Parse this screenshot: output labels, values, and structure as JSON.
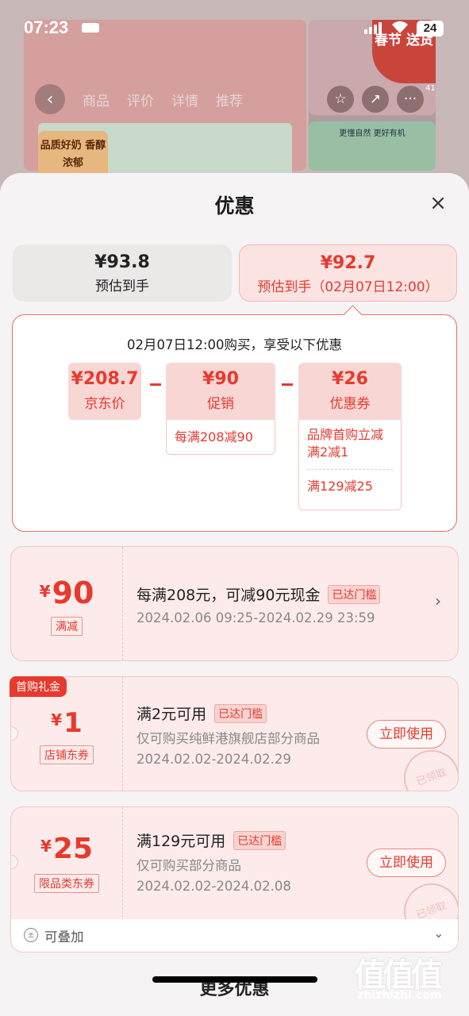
{
  "status_bar": {
    "time": "07:23",
    "battery": "24"
  },
  "background": {
    "nav_tabs": [
      "商品",
      "评价",
      "详情",
      "推荐"
    ],
    "hero_tag": "品质好奶 香醇浓郁",
    "ad_badge": "春节 送货",
    "ad_text": "更懂自然 更好有机",
    "cart_count": "41"
  },
  "sheet": {
    "title": "优惠",
    "close_icon": "close-icon",
    "price_tabs": [
      {
        "price": "¥93.8",
        "label": "预估到手"
      },
      {
        "price": "¥92.7",
        "label": "预估到手（02月07日12:00）"
      }
    ],
    "detail": {
      "header": "02月07日12:00购买，享受以下优惠",
      "jd_price": {
        "value": "¥208.7",
        "name": "京东价"
      },
      "promo": {
        "value": "¥90",
        "name": "促销",
        "desc": "每满208减90"
      },
      "coupon": {
        "value": "¥26",
        "name": "优惠券",
        "desc1": "品牌首购立减满2减1",
        "desc2": "满129减25"
      }
    },
    "offers": [
      {
        "amount": "90",
        "yen": "¥",
        "kind": "满减",
        "title": "每满208元，可减90元现金",
        "badge": "已达门槛",
        "date": "2024.02.06 09:25-2024.02.29 23:59"
      },
      {
        "tag": "首购礼金",
        "amount": "1",
        "yen": "¥",
        "kind": "店铺东券",
        "title": "满2元可用",
        "badge": "已达门槛",
        "desc": "仅可购买纯鲜港旗舰店部分商品",
        "date": "2024.02.02-2024.02.29",
        "button": "立即使用",
        "stamp": "已领取"
      },
      {
        "amount": "25",
        "yen": "¥",
        "kind": "限品类东券",
        "title": "满129元可用",
        "badge": "已达门槛",
        "desc": "仅可购买部分商品",
        "date": "2024.02.02-2024.02.08",
        "button": "立即使用",
        "stamp": "已领取"
      }
    ],
    "stackable": "可叠加",
    "more_title": "更多优惠"
  },
  "watermark": {
    "logo": "值值值",
    "url": "zhizhizhi.com"
  },
  "colors": {
    "accent": "#e63a2e",
    "sheet_bg": "#f5f3f3",
    "coupon_bg": "#fcebea"
  }
}
